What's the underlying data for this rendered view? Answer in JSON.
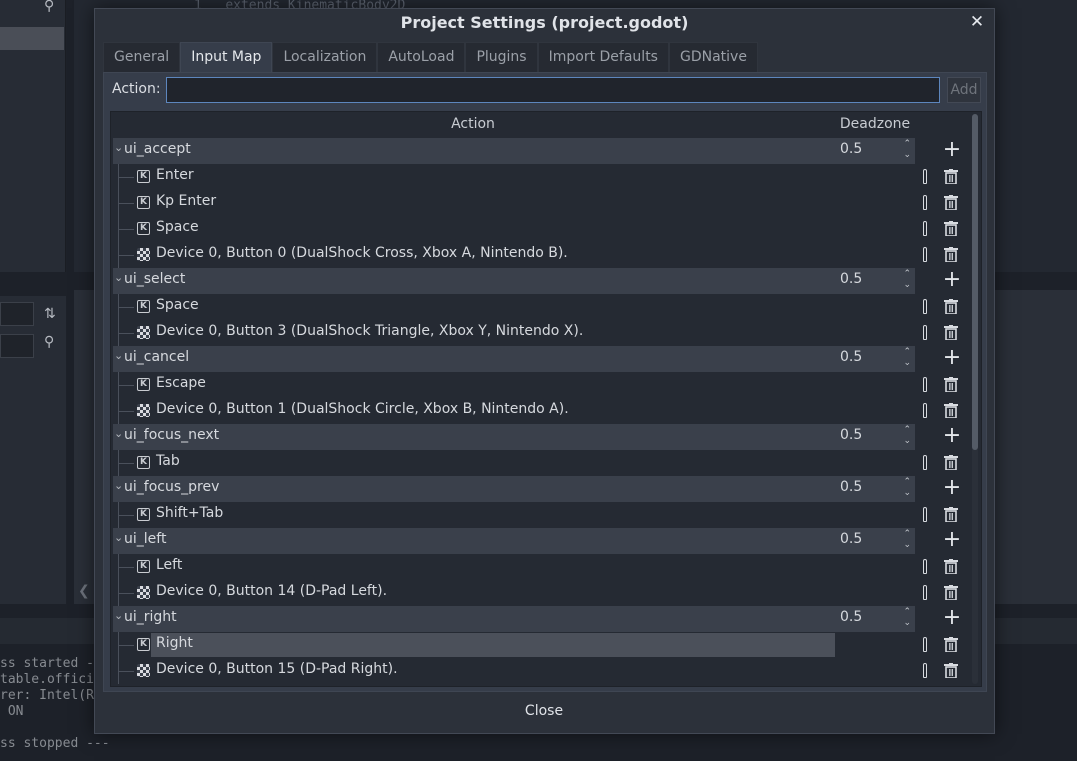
{
  "background": {
    "code_line_number": "1",
    "code_text": "extends KinematicBody2D",
    "output_lines": [
      "ss started -",
      "table.offici",
      "rer: Intel(R",
      " ON",
      "ss stopped ---"
    ]
  },
  "dialog": {
    "title": "Project Settings (project.godot)",
    "close_icon": "close-icon",
    "close_label": "Close"
  },
  "tabs": [
    "General",
    "Input Map",
    "Localization",
    "AutoLoad",
    "Plugins",
    "Import Defaults",
    "GDNative"
  ],
  "active_tab": "Input Map",
  "action_bar": {
    "label": "Action:",
    "value": "",
    "add_label": "Add"
  },
  "tree": {
    "col_action": "Action",
    "col_deadzone": "Deadzone",
    "groups": [
      {
        "name": "ui_accept",
        "deadzone": "0.5",
        "events": [
          {
            "type": "key",
            "label": "Enter"
          },
          {
            "type": "key",
            "label": "Kp Enter"
          },
          {
            "type": "key",
            "label": "Space"
          },
          {
            "type": "joy",
            "label": "Device 0, Button 0 (DualShock Cross, Xbox A, Nintendo B)."
          }
        ]
      },
      {
        "name": "ui_select",
        "deadzone": "0.5",
        "events": [
          {
            "type": "key",
            "label": "Space"
          },
          {
            "type": "joy",
            "label": "Device 0, Button 3 (DualShock Triangle, Xbox Y, Nintendo X)."
          }
        ]
      },
      {
        "name": "ui_cancel",
        "deadzone": "0.5",
        "events": [
          {
            "type": "key",
            "label": "Escape"
          },
          {
            "type": "joy",
            "label": "Device 0, Button 1 (DualShock Circle, Xbox B, Nintendo A)."
          }
        ]
      },
      {
        "name": "ui_focus_next",
        "deadzone": "0.5",
        "events": [
          {
            "type": "key",
            "label": "Tab"
          }
        ]
      },
      {
        "name": "ui_focus_prev",
        "deadzone": "0.5",
        "events": [
          {
            "type": "key",
            "label": "Shift+Tab"
          }
        ]
      },
      {
        "name": "ui_left",
        "deadzone": "0.5",
        "events": [
          {
            "type": "key",
            "label": "Left"
          },
          {
            "type": "joy",
            "label": "Device 0, Button 14 (D-Pad Left)."
          }
        ]
      },
      {
        "name": "ui_right",
        "deadzone": "0.5",
        "events": [
          {
            "type": "key",
            "label": "Right",
            "selected": true
          },
          {
            "type": "joy",
            "label": "Device 0, Button 15 (D-Pad Right)."
          }
        ]
      }
    ]
  },
  "icons": {
    "expanded": "chevron-down-icon",
    "key": "keyboard-key-icon",
    "joy": "joypad-button-icon",
    "edit": "edit-icon",
    "add": "plus-icon",
    "remove": "trash-icon",
    "spin": "spinner-arrows-icon"
  }
}
